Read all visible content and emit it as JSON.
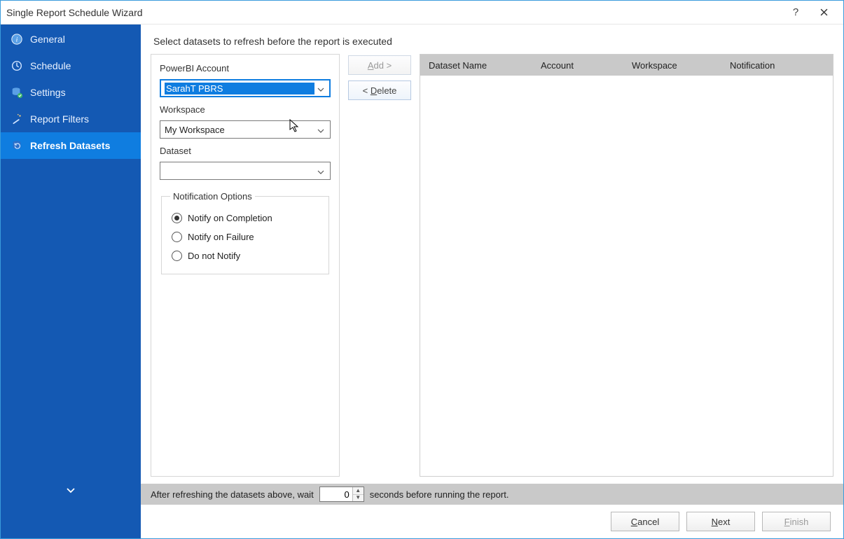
{
  "window": {
    "title": "Single Report Schedule Wizard"
  },
  "sidebar": {
    "items": [
      {
        "label": "General"
      },
      {
        "label": "Schedule"
      },
      {
        "label": "Settings"
      },
      {
        "label": "Report Filters"
      },
      {
        "label": "Refresh Datasets"
      }
    ],
    "active_index": 4
  },
  "instruction": "Select datasets to refresh before the report is executed",
  "form": {
    "account_label": "PowerBI Account",
    "account_value": "SarahT PBRS",
    "workspace_label": "Workspace",
    "workspace_value": "My Workspace",
    "dataset_label": "Dataset",
    "dataset_value": ""
  },
  "notification": {
    "legend": "Notification Options",
    "options": [
      {
        "label": "Notify on Completion",
        "selected": true
      },
      {
        "label": "Notify on Failure",
        "selected": false
      },
      {
        "label": "Do not Notify",
        "selected": false
      }
    ]
  },
  "actions": {
    "add_label_pre": "A",
    "add_label_post": "dd >",
    "delete_label_pre": "< ",
    "delete_label_u": "D",
    "delete_label_post": "elete"
  },
  "table": {
    "columns": {
      "name": "Dataset Name",
      "account": "Account",
      "workspace": "Workspace",
      "notification": "Notification"
    },
    "rows": []
  },
  "wait": {
    "before": "After refreshing the datasets above, wait",
    "value": "0",
    "after": "seconds before running the report."
  },
  "footer": {
    "cancel_u": "C",
    "cancel_rest": "ancel",
    "next_u": "N",
    "next_rest": "ext",
    "finish_u": "F",
    "finish_rest": "inish"
  }
}
